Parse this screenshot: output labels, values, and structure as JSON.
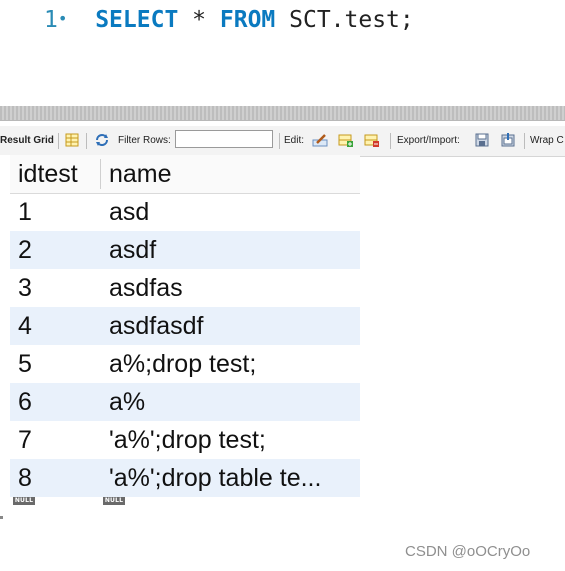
{
  "editor": {
    "line_number": "1",
    "line_marker": "•",
    "tokens": {
      "select": "SELECT",
      "star": "*",
      "from": "FROM",
      "table": "SCT.test;"
    }
  },
  "toolbar": {
    "result_grid": "Result Grid",
    "filter_rows": "Filter Rows:",
    "filter_value": "",
    "edit": "Edit:",
    "export_import": "Export/Import:",
    "wrap": "Wrap C"
  },
  "grid": {
    "columns": [
      "idtest",
      "name"
    ],
    "rows": [
      [
        "1",
        "asd"
      ],
      [
        "2",
        "asdf"
      ],
      [
        "3",
        "asdfas"
      ],
      [
        "4",
        "asdfasdf"
      ],
      [
        "5",
        "a%;drop test;"
      ],
      [
        "6",
        "a%"
      ],
      [
        "7",
        "'a%';drop test;"
      ],
      [
        "8",
        "'a%';drop table te..."
      ]
    ],
    "null_label": "NULL"
  },
  "watermark": "CSDN @oOCryOo",
  "colors": {
    "keyword": "#0a7ac0",
    "row_alt": "#e9f1fb",
    "toolbar_bg": "#f3f3f3"
  }
}
